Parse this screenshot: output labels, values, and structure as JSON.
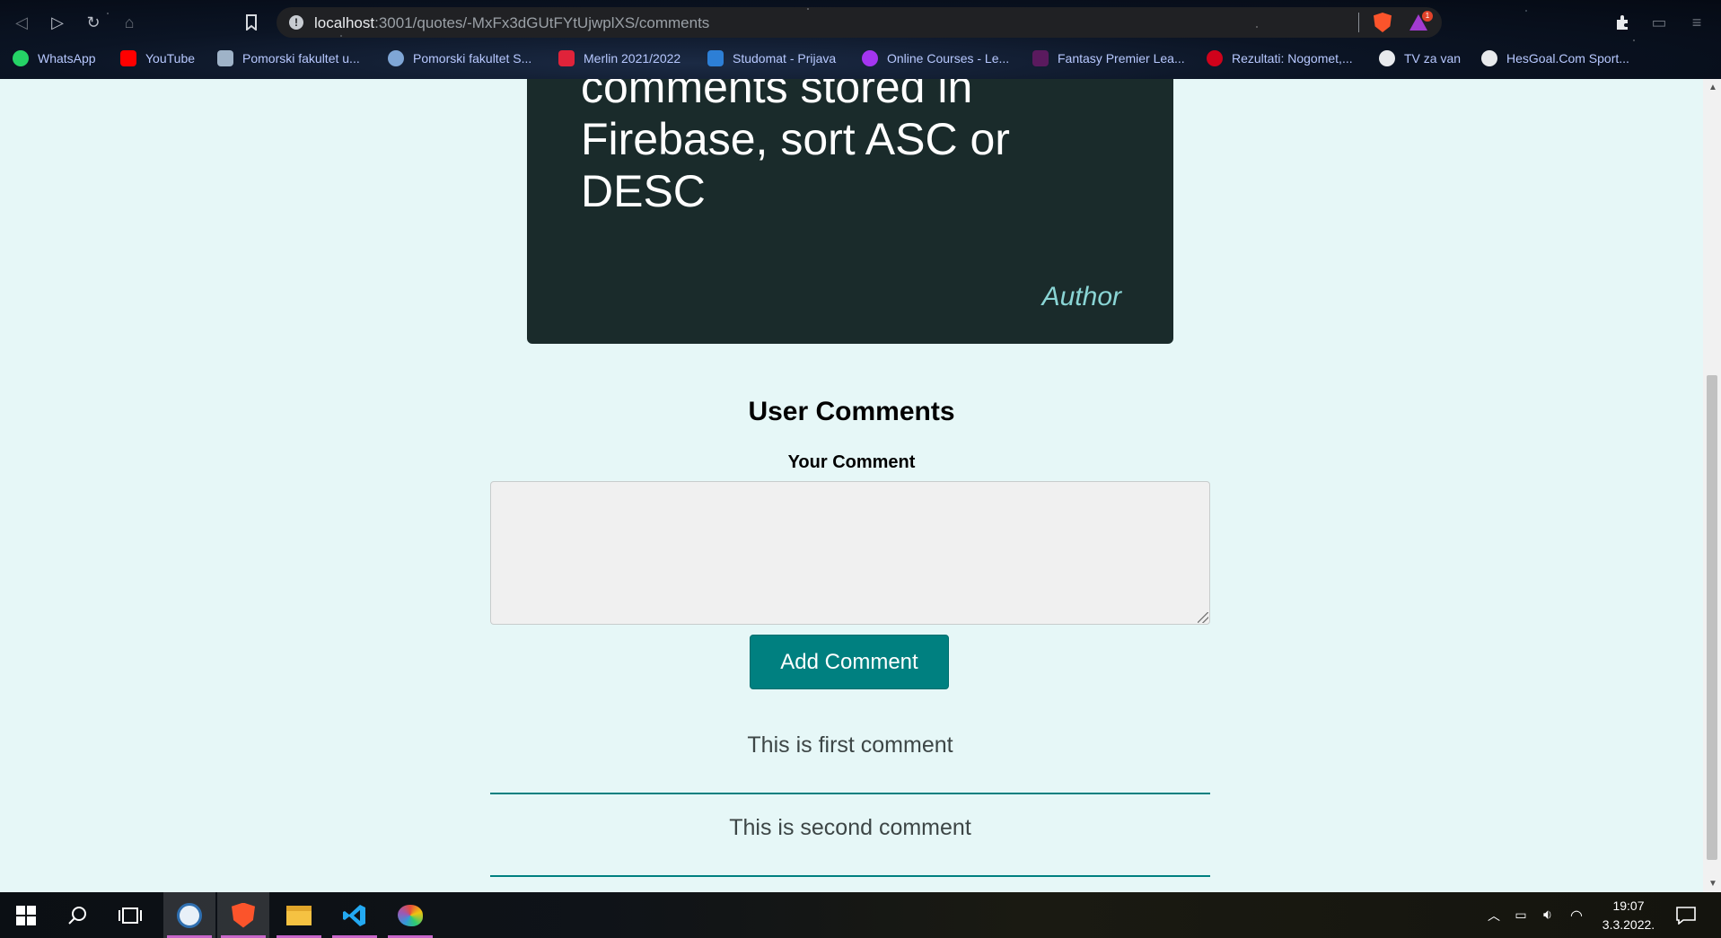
{
  "browser": {
    "url_host": "localhost",
    "url_path": ":3001/quotes/-MxFx3dGUtFYtUjwplXS/comments",
    "rewards_badge": "1",
    "bookmarks": [
      {
        "label": "WhatsApp",
        "icon": "whatsapp-icon",
        "color": "#25d366"
      },
      {
        "label": "YouTube",
        "icon": "youtube-icon",
        "color": "#ff0000"
      },
      {
        "label": "Pomorski fakultet u...",
        "icon": "faculty-icon",
        "color": "#9fb3c8"
      },
      {
        "label": "Pomorski fakultet S...",
        "icon": "faculty-icon",
        "color": "#7fa6d6"
      },
      {
        "label": "Merlin 2021/2022",
        "icon": "merlin-icon",
        "color": "#e0233a"
      },
      {
        "label": "Studomat - Prijava",
        "icon": "studomat-icon",
        "color": "#2d7fd6"
      },
      {
        "label": "Online Courses - Le...",
        "icon": "udemy-icon",
        "color": "#a435f0"
      },
      {
        "label": "Fantasy Premier Lea...",
        "icon": "fpl-icon",
        "color": "#37003c"
      },
      {
        "label": "Rezultati: Nogomet,...",
        "icon": "results-icon",
        "color": "#d0021b"
      },
      {
        "label": "TV za van",
        "icon": "globe-icon",
        "color": "#e8eaed"
      },
      {
        "label": "HesGoal.Com Sport...",
        "icon": "football-icon",
        "color": "#e8eaed"
      }
    ]
  },
  "quote": {
    "text": "comments stored in Firebase, sort ASC or DESC",
    "author": "Author"
  },
  "comments_section": {
    "title": "User Comments",
    "field_label": "Your Comment",
    "textarea_value": "",
    "button_label": "Add Comment",
    "items": [
      "This is first comment",
      "This is second comment"
    ]
  },
  "taskbar": {
    "time": "19:07",
    "date": "3.3.2022.",
    "accent": "#c766c9"
  }
}
